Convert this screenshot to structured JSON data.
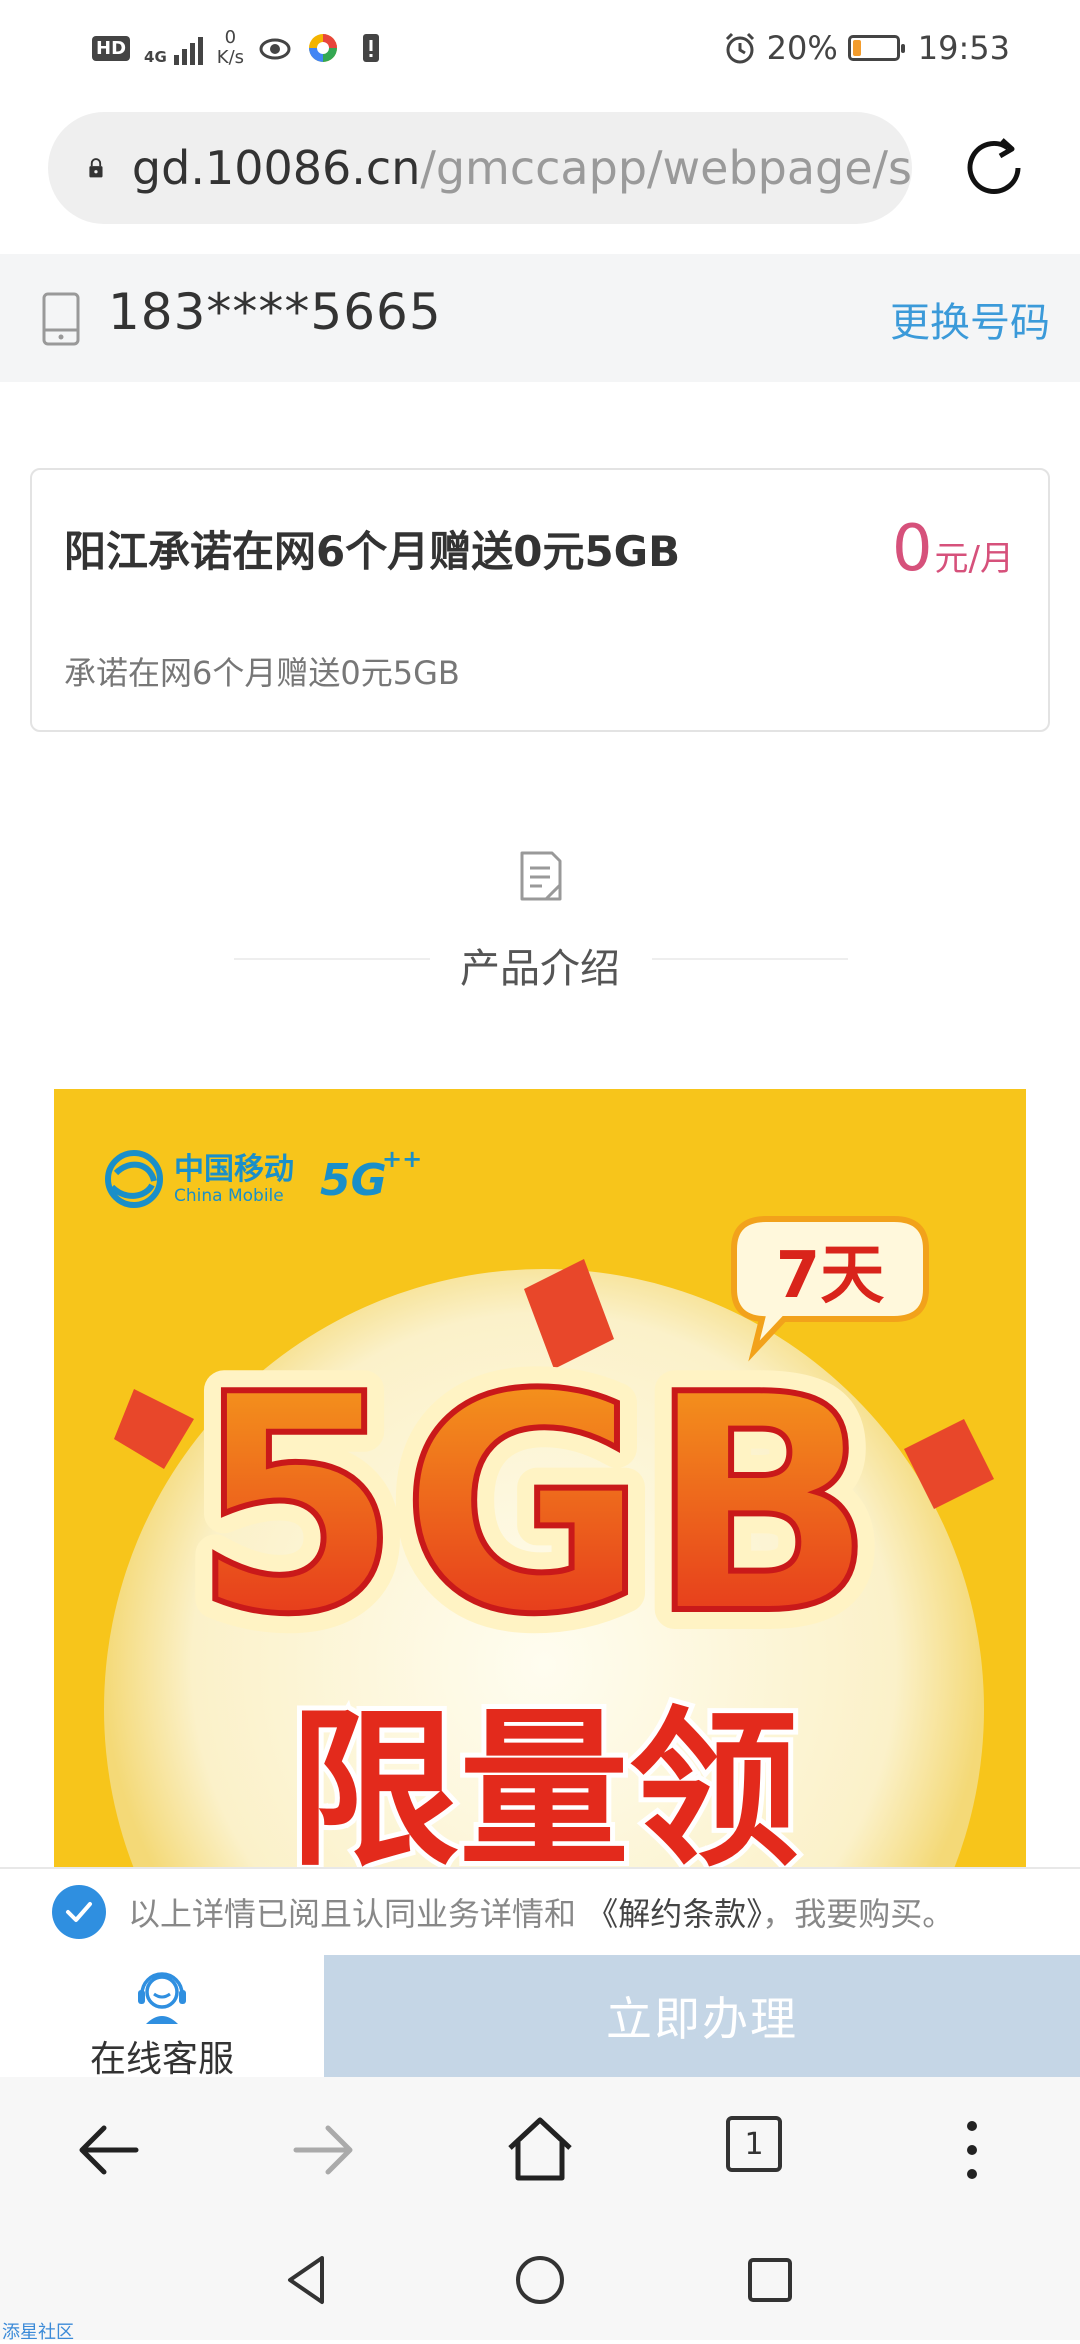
{
  "status_bar": {
    "hd": "HD",
    "network": "4G",
    "speed_value": "0",
    "speed_unit": "K/s",
    "battery_text": "20%",
    "battery_level": 0.2,
    "time": "19:53"
  },
  "browser": {
    "url_host": "gd.10086.cn",
    "url_path": "/gmccapp/webpage/s",
    "tab_count": "1"
  },
  "account": {
    "phone_number": "183****5665",
    "change_label": "更换号码"
  },
  "product": {
    "title": "阳江承诺在网6个月赠送0元5GB",
    "subtitle": "承诺在网6个月赠送0元5GB",
    "price": "0",
    "price_unit": "元/月"
  },
  "intro": {
    "section_title": "产品介绍"
  },
  "banner": {
    "brand_cn": "中国移动",
    "brand_en": "China Mobile",
    "badge_5g": "5G",
    "badge_plus": "++",
    "days": "7天",
    "headline": "5GB",
    "subheadline": "限量领",
    "colors": {
      "background": "#f7c51b",
      "orange": "#f26a1b",
      "red": "#e32a1c"
    }
  },
  "agreement": {
    "text_before": "以上详情已阅且认同业务详情和",
    "link": "《解约条款》",
    "text_after": "，我要购买。"
  },
  "actions": {
    "service_label": "在线客服",
    "submit_label": "立即办理"
  },
  "watermark": "添星社区"
}
